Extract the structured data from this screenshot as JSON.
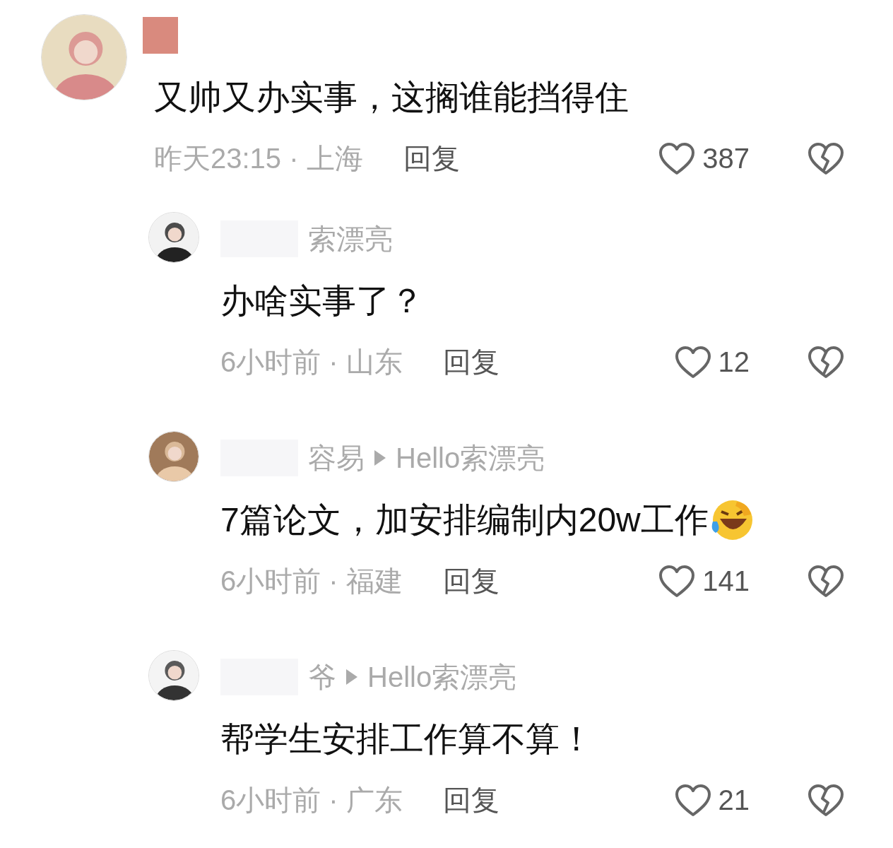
{
  "comments": [
    {
      "name_redacted": true,
      "text": "又帅又办实事，这搁谁能挡得住",
      "time_location": "昨天23:15 · 上海",
      "reply_label": "回复",
      "likes": "387",
      "liked": false,
      "replies": [
        {
          "name_redacted": true,
          "name": "索漂亮",
          "text": "办啥实事了？",
          "time_location": "6小时前 · 山东",
          "reply_label": "回复",
          "likes": "12",
          "liked": false
        },
        {
          "name_redacted": true,
          "name": "容易",
          "reply_to": "Hello索漂亮",
          "text": "7篇论文，加安排编制内20w工作",
          "emoji": {
            "kind": "laughing"
          },
          "time_location": "6小时前 · 福建",
          "reply_label": "回复",
          "likes": "141",
          "liked": false
        },
        {
          "name_redacted": true,
          "name": "爷",
          "reply_to": "Hello索漂亮",
          "text": "帮学生安排工作算不算！",
          "time_location": "6小时前 · 广东",
          "reply_label": "回复",
          "likes": "21",
          "liked": false
        }
      ]
    }
  ]
}
